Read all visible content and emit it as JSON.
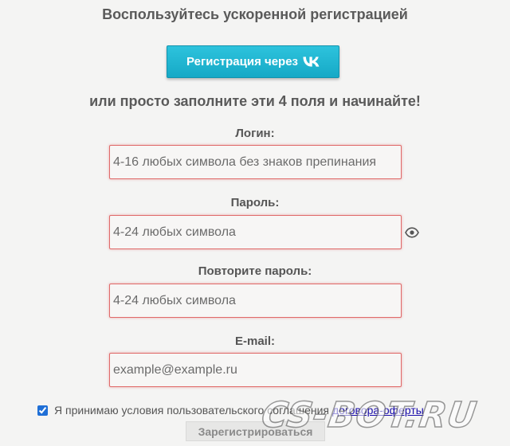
{
  "header": {
    "fast_registration": "Воспользуйтесь ускоренной регистрацией",
    "vk_button": "Регистрация через",
    "vk_logo": "vk-logo-icon",
    "or_fill": "или просто заполните эти 4 поля и начинайте!"
  },
  "form": {
    "login": {
      "label": "Логин:",
      "placeholder": "4-16 любых символа без знаков препинания",
      "value": ""
    },
    "password": {
      "label": "Пароль:",
      "placeholder": "4-24 любых символа",
      "value": "",
      "toggle_icon": "eye-icon"
    },
    "password_repeat": {
      "label": "Повторите пароль:",
      "placeholder": "4-24 любых символа",
      "value": ""
    },
    "email": {
      "label": "E-mail:",
      "placeholder": "example@example.ru",
      "value": ""
    },
    "agreement": {
      "checked": true,
      "text": "Я принимаю условия пользовательского соглашения",
      "link": "договора-оферты"
    },
    "submit_label": "Зарегистрироваться"
  },
  "watermark": {
    "text": "CS-BOT.RU"
  },
  "colors": {
    "vk_button": "#16a9c6",
    "field_border": "#e06a6a",
    "link": "#1a0dab",
    "background": "#f4f4f3"
  }
}
